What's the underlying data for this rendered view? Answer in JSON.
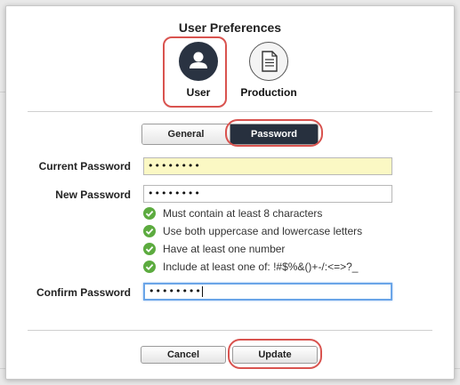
{
  "dialog": {
    "title": "User Preferences",
    "roles": [
      {
        "label": "User",
        "icon": "user-icon",
        "selected": true
      },
      {
        "label": "Production",
        "icon": "document-icon",
        "selected": false
      }
    ],
    "tabs": [
      {
        "label": "General",
        "selected": false
      },
      {
        "label": "Password",
        "selected": true
      }
    ],
    "fields": {
      "current_password": {
        "label": "Current Password",
        "value": "••••••••"
      },
      "new_password": {
        "label": "New Password",
        "value": "••••••••"
      },
      "confirm_password": {
        "label": "Confirm Password",
        "value": "••••••••"
      }
    },
    "rules": [
      "Must contain at least 8 characters",
      "Use both uppercase and lowercase letters",
      "Have at least one number",
      "Include at least one of: !#$%&()+-/:<=>?_"
    ],
    "buttons": {
      "cancel": "Cancel",
      "update": "Update"
    }
  },
  "colors": {
    "accent_dark": "#27303e",
    "highlight_red": "#d9534f",
    "check_green": "#5cab3f",
    "autofill_yellow": "#fbf8c4"
  }
}
